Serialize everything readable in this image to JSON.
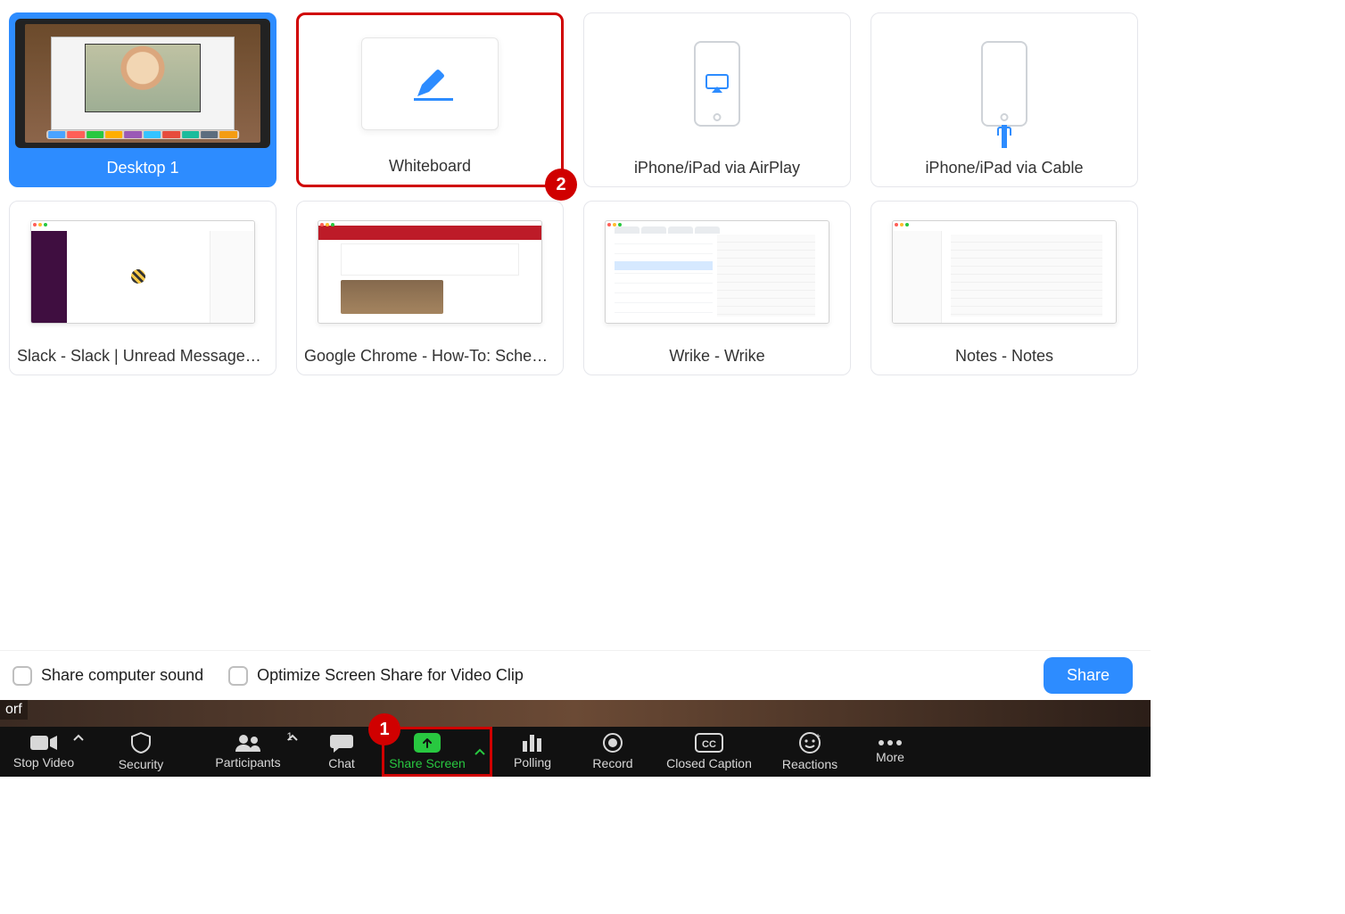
{
  "share_sources": {
    "desktop": {
      "label": "Desktop 1"
    },
    "whiteboard": {
      "label": "Whiteboard"
    },
    "airplay": {
      "label": "iPhone/iPad via AirPlay"
    },
    "cable": {
      "label": "iPhone/iPad via Cable"
    },
    "slack": {
      "label": "Slack - Slack | Unread Messages |..."
    },
    "chrome": {
      "label": "Google Chrome - How-To: Schedul..."
    },
    "wrike": {
      "label": "Wrike - Wrike"
    },
    "notes": {
      "label": "Notes - Notes"
    }
  },
  "footer": {
    "share_sound_label": "Share computer sound",
    "optimize_label": "Optimize Screen Share for Video Clip",
    "share_button_label": "Share"
  },
  "name_overlay": "orf",
  "controls": {
    "stop_video": "Stop Video",
    "security": "Security",
    "participants": "Participants",
    "participants_count": "1",
    "chat": "Chat",
    "share_screen": "Share Screen",
    "polling": "Polling",
    "record": "Record",
    "closed_caption": "Closed Caption",
    "reactions": "Reactions",
    "more": "More"
  },
  "callouts": {
    "one": "1",
    "two": "2"
  },
  "colors": {
    "accent_blue": "#2d8cff",
    "accent_green": "#28c840",
    "highlight_red": "#d00000"
  }
}
